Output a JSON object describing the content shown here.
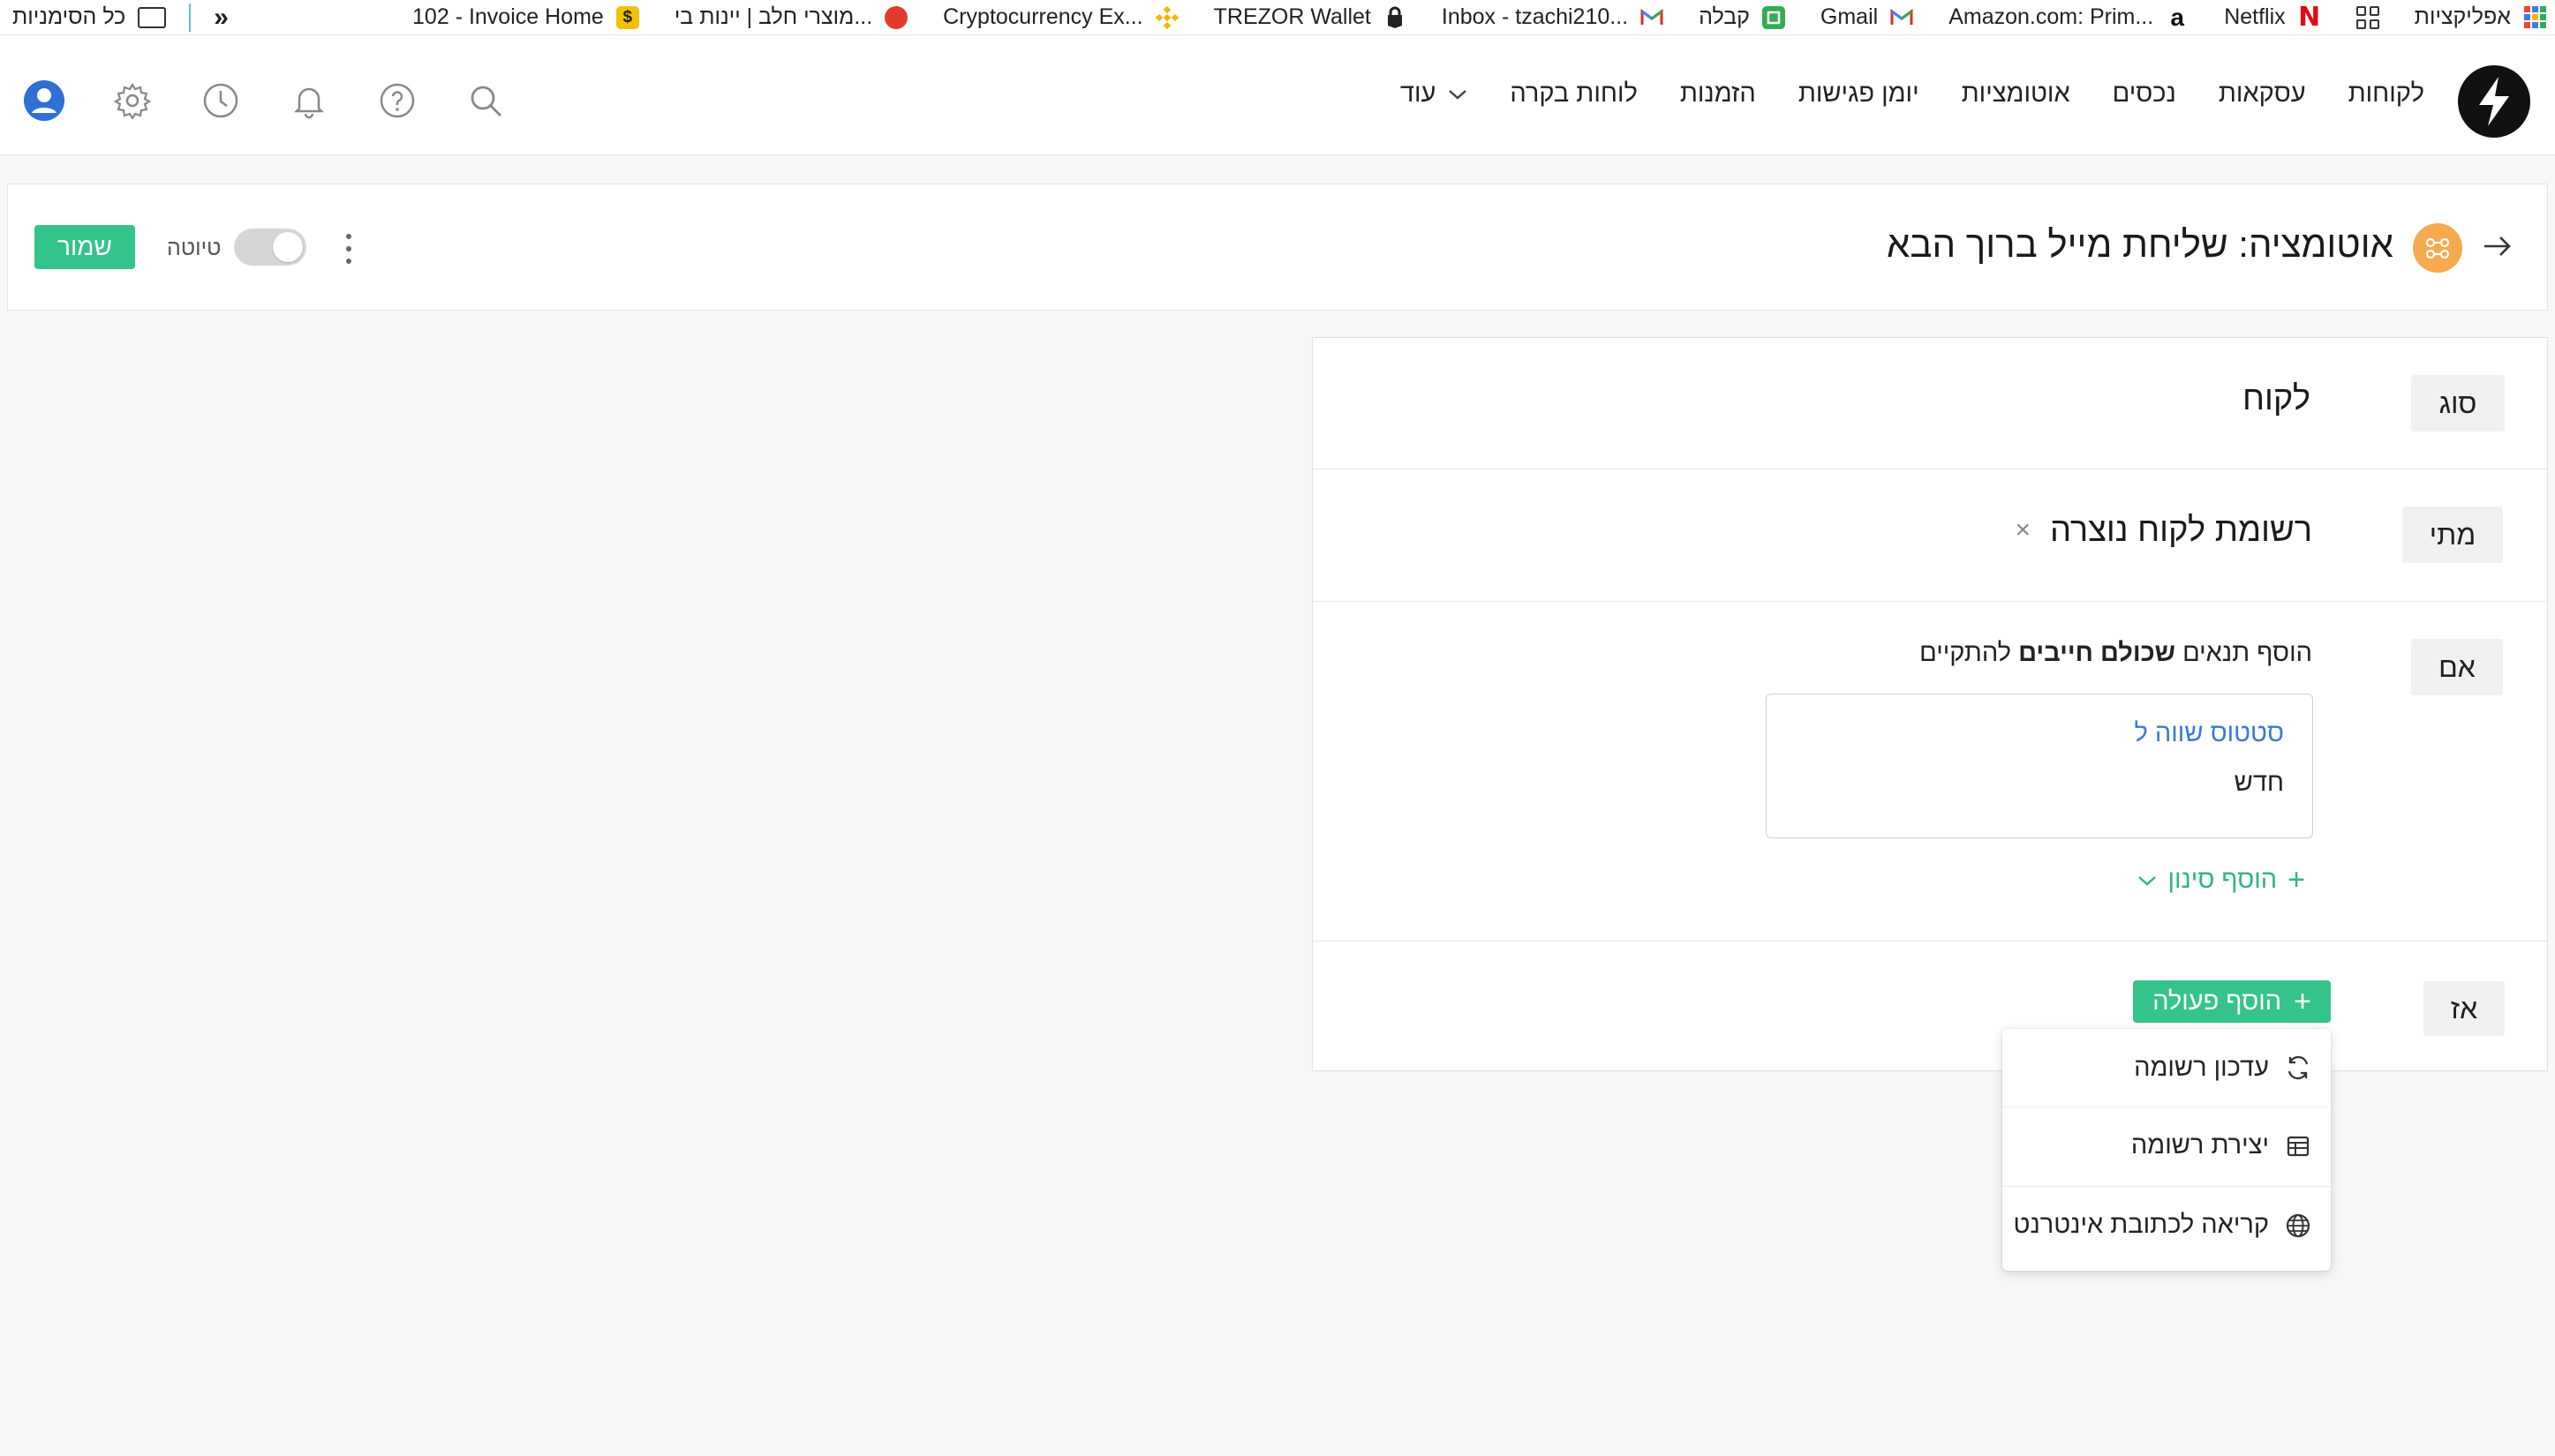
{
  "bookmarks": {
    "items": [
      {
        "label": "אפליקציות",
        "icon": "apps-grid-icon"
      },
      {
        "label": "",
        "icon": "squares-icon"
      },
      {
        "label": "Netflix",
        "icon": "netflix-icon",
        "color": "#e50914"
      },
      {
        "label": "Amazon.com: Prim...",
        "icon": "amazon-icon"
      },
      {
        "label": "Gmail",
        "icon": "gmail-icon"
      },
      {
        "label": "קבלה",
        "icon": "receipt-icon",
        "color": "#2fae52"
      },
      {
        "label": "Inbox - tzachi210...",
        "icon": "gmail-icon"
      },
      {
        "label": "TREZOR Wallet",
        "icon": "trezor-icon"
      },
      {
        "label": "Cryptocurrency Ex...",
        "icon": "binance-icon",
        "color": "#f0b90b"
      },
      {
        "label": "מוצרי חלב | יינות בי...",
        "icon": "dairy-icon",
        "color": "#e23b2e"
      },
      {
        "label": "102 - Invoice Home",
        "icon": "dollar-icon",
        "color": "#f2c200"
      }
    ],
    "overflow": "»",
    "all_bookmarks": "כל הסימניות"
  },
  "nav": {
    "items": [
      "לקוחות",
      "עסקאות",
      "נכסים",
      "אוטומציות",
      "יומן פגישות",
      "הזמנות",
      "לוחות בקרה"
    ],
    "more": "עוד",
    "icons": [
      "avatar-icon",
      "settings-icon",
      "clock-icon",
      "bell-icon",
      "help-icon",
      "search-icon"
    ]
  },
  "automation": {
    "title": "אוטומציה: שליחת מייל ברוך הבא",
    "draft_label": "טיוטה",
    "draft_enabled": false,
    "save_label": "שמור"
  },
  "builder": {
    "type": {
      "label": "סוג",
      "value": "לקוח"
    },
    "when": {
      "label": "מתי",
      "value": "רשומת לקוח נוצרה",
      "clear": "×"
    },
    "if": {
      "label": "אם",
      "title_prefix": "הוסף תנאים",
      "title_bold": "שכולם חייבים",
      "title_suffix": "להתקיים",
      "condition": {
        "field": "סטטוס שווה ל",
        "value": "חדש"
      },
      "add_filter": "הוסף סינון",
      "add_filter_plus": "+"
    },
    "then": {
      "label": "אז",
      "add_action": "הוסף פעולה",
      "add_action_plus": "+"
    }
  },
  "action_menu": {
    "items": [
      {
        "label": "עדכון רשומה",
        "icon": "refresh-icon"
      },
      {
        "label": "יצירת רשומה",
        "icon": "table-icon"
      },
      {
        "label": "קריאה לכתובת אינטרנט",
        "icon": "globe-icon"
      }
    ]
  },
  "colors": {
    "accent_green": "#35c38c",
    "link_blue": "#3d78d8",
    "badge_orange": "#f7a94f",
    "avatar_blue": "#2f6fd6"
  }
}
